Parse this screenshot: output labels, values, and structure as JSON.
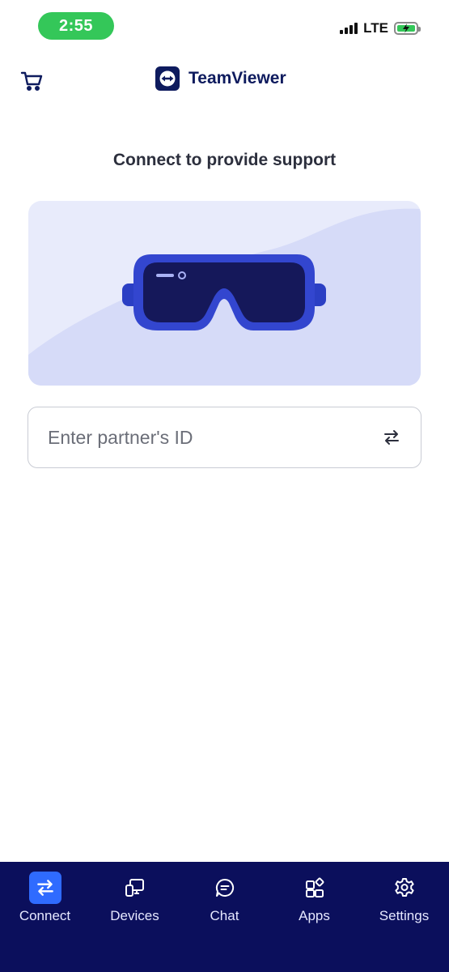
{
  "status_bar": {
    "time": "2:55",
    "network": "LTE"
  },
  "header": {
    "brand_name": "TeamViewer",
    "cart_icon": "cart-icon",
    "logo_icon": "teamviewer-logo"
  },
  "main": {
    "title": "Connect to provide support",
    "illustration": "vr-goggles",
    "partner_id": {
      "value": "",
      "placeholder": "Enter partner's ID",
      "action_icon": "swap-arrows-icon"
    }
  },
  "bottom_nav": {
    "items": [
      {
        "label": "Connect",
        "icon": "swap-arrows-icon",
        "active": true
      },
      {
        "label": "Devices",
        "icon": "devices-icon",
        "active": false
      },
      {
        "label": "Chat",
        "icon": "chat-icon",
        "active": false
      },
      {
        "label": "Apps",
        "icon": "apps-icon",
        "active": false
      },
      {
        "label": "Settings",
        "icon": "gear-icon",
        "active": false
      }
    ]
  },
  "colors": {
    "brand": "#0e1b5e",
    "nav_background": "#0b0f5c",
    "active_accent": "#2f6bff",
    "status_green": "#34c759"
  }
}
